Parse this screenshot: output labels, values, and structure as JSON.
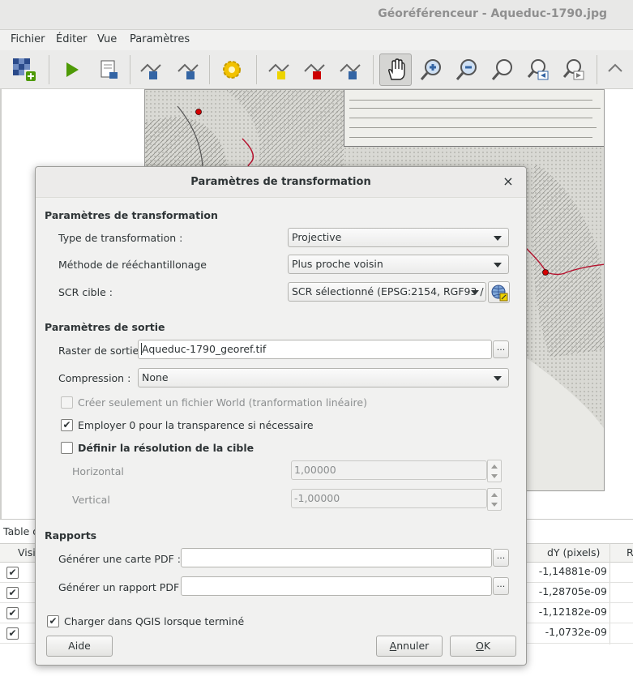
{
  "window": {
    "title": "Géoréférenceur - Aqueduc-1790.jpg"
  },
  "menu": [
    "Fichier",
    "Éditer",
    "Vue",
    "Paramètres"
  ],
  "toolbar_icons": [
    "add-raster-icon",
    "play-icon",
    "generate-script-icon",
    "add-point-icon",
    "delete-point-icon",
    "settings-gear-icon",
    "pan-tool-icon",
    "zoom-in-icon",
    "zoom-out-icon",
    "zoom-layer-icon",
    "zoom-last-icon",
    "zoom-next-icon"
  ],
  "gcp_table": {
    "label": "Table d",
    "col_visible": "Visil",
    "col_dy": "dY (pixels)",
    "col_r": "R",
    "rows": [
      {
        "checked": true,
        "dy": "-1,14881e-09"
      },
      {
        "checked": true,
        "dy": "-1,28705e-09"
      },
      {
        "checked": true,
        "dy": "-1,12182e-09"
      },
      {
        "checked": true,
        "dy": "-1,0732e-09"
      }
    ]
  },
  "dialog": {
    "title": "Paramètres de transformation",
    "close": "×",
    "section_transform": "Paramètres de transformation",
    "transform_type_label": "Type de transformation :",
    "transform_type_value": "Projective",
    "resampling_label": "Méthode de rééchantillonage",
    "resampling_value": "Plus proche voisin",
    "crs_label": "SCR cible :",
    "crs_value": "SCR sélectionné (EPSG:2154, RGF93 /",
    "section_output": "Paramètres de sortie",
    "raster_label": "Raster de sortie",
    "raster_value": "Aqueduc-1790_georef.tif",
    "browse": "...",
    "compression_label": "Compression :",
    "compression_value": "None",
    "world_file_label": "Créer seulement un fichier World (tranformation linéaire)",
    "world_file_checked": false,
    "transparency_label": "Employer 0 pour la transparence si nécessaire",
    "transparency_checked": true,
    "resolution_label": "Définir la résolution de la cible",
    "resolution_checked": false,
    "horizontal_label": "Horizontal",
    "horizontal_value": "1,00000",
    "vertical_label": "Vertical",
    "vertical_value": "-1,00000",
    "section_reports": "Rapports",
    "pdf_map_label": "Générer une carte PDF :",
    "pdf_map_value": "",
    "pdf_report_label": "Générer un rapport PDF :",
    "pdf_report_value": "",
    "load_qgis_label": "Charger dans QGIS lorsque terminé",
    "load_qgis_checked": true,
    "help_button": "Aide",
    "cancel_button_first": "A",
    "cancel_button_rest": "nnuler",
    "ok_button_first": "O",
    "ok_button_rest": "K"
  }
}
